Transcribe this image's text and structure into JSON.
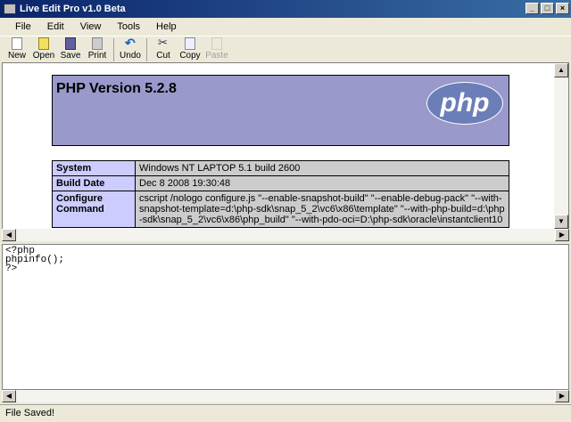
{
  "window": {
    "title": "Live Edit Pro v1.0 Beta",
    "min": "_",
    "max": "□",
    "close": "×"
  },
  "menu": [
    "File",
    "Edit",
    "View",
    "Tools",
    "Help"
  ],
  "toolbar": [
    {
      "label": "New",
      "icon": "new-icon"
    },
    {
      "label": "Open",
      "icon": "open-icon"
    },
    {
      "label": "Save",
      "icon": "save-icon"
    },
    {
      "label": "Print",
      "icon": "print-icon"
    },
    {
      "label": "Undo",
      "icon": "undo-icon"
    },
    {
      "label": "Cut",
      "icon": "cut-icon"
    },
    {
      "label": "Copy",
      "icon": "copy-icon"
    },
    {
      "label": "Paste",
      "icon": "paste-icon"
    }
  ],
  "preview": {
    "title": "PHP Version 5.2.8",
    "logo": "php",
    "rows": [
      {
        "k": "System",
        "v": "Windows NT LAPTOP 5.1 build 2600"
      },
      {
        "k": "Build Date",
        "v": "Dec 8 2008 19:30:48"
      },
      {
        "k": "Configure Command",
        "v": "cscript /nologo configure.js \"--enable-snapshot-build\" \"--enable-debug-pack\" \"--with-snapshot-template=d:\\php-sdk\\snap_5_2\\vc6\\x86\\template\" \"--with-php-build=d:\\php-sdk\\snap_5_2\\vc6\\x86\\php_build\" \"--with-pdo-oci=D:\\php-sdk\\oracle\\instantclient10"
      }
    ]
  },
  "editor": {
    "code": "<?php\nphpinfo();\n?>"
  },
  "status": "File Saved!"
}
